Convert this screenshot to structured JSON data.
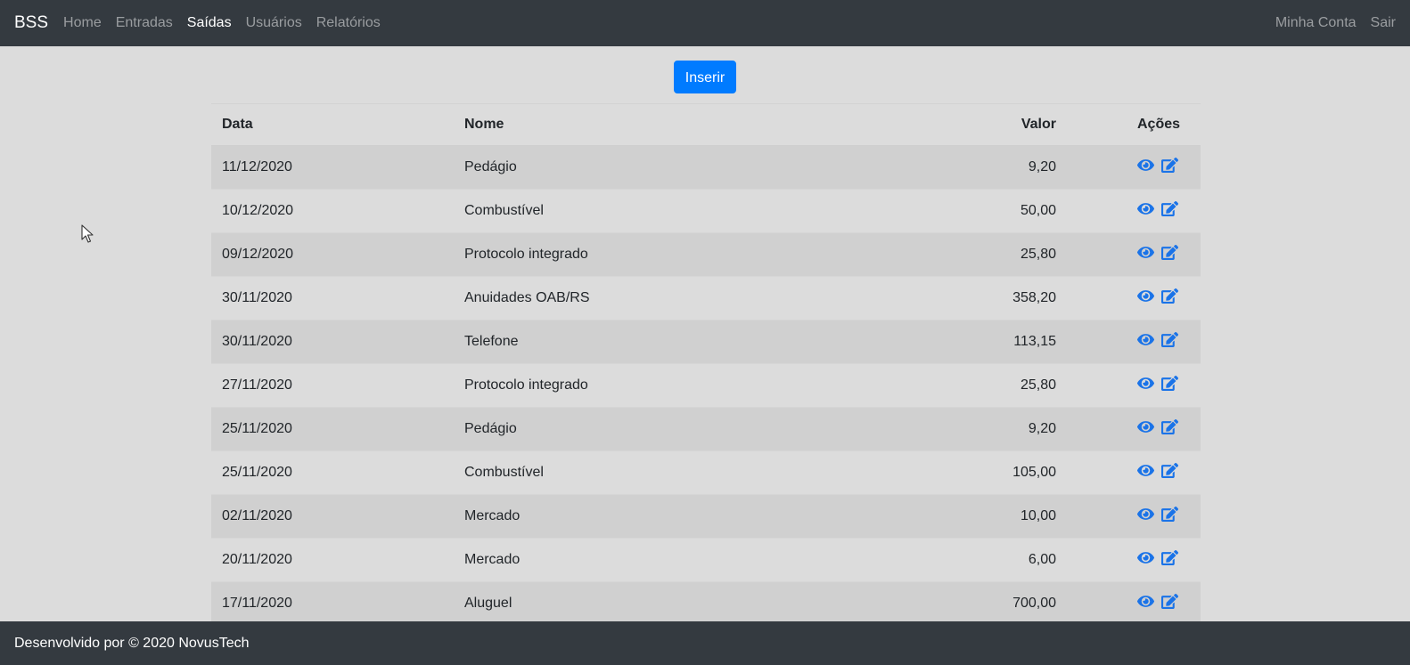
{
  "navbar": {
    "brand": "BSS",
    "links": [
      {
        "label": "Home",
        "active": false
      },
      {
        "label": "Entradas",
        "active": false
      },
      {
        "label": "Saídas",
        "active": true
      },
      {
        "label": "Usuários",
        "active": false
      },
      {
        "label": "Relatórios",
        "active": false
      }
    ],
    "right_links": [
      {
        "label": "Minha Conta"
      },
      {
        "label": "Sair"
      }
    ]
  },
  "actions": {
    "insert_label": "Inserir"
  },
  "table": {
    "headers": {
      "data": "Data",
      "nome": "Nome",
      "valor": "Valor",
      "acoes": "Ações"
    },
    "rows": [
      {
        "data": "11/12/2020",
        "nome": "Pedágio",
        "valor": "9,20"
      },
      {
        "data": "10/12/2020",
        "nome": "Combustível",
        "valor": "50,00"
      },
      {
        "data": "09/12/2020",
        "nome": "Protocolo integrado",
        "valor": "25,80"
      },
      {
        "data": "30/11/2020",
        "nome": "Anuidades OAB/RS",
        "valor": "358,20"
      },
      {
        "data": "30/11/2020",
        "nome": "Telefone",
        "valor": "113,15"
      },
      {
        "data": "27/11/2020",
        "nome": "Protocolo integrado",
        "valor": "25,80"
      },
      {
        "data": "25/11/2020",
        "nome": "Pedágio",
        "valor": "9,20"
      },
      {
        "data": "25/11/2020",
        "nome": "Combustível",
        "valor": "105,00"
      },
      {
        "data": "02/11/2020",
        "nome": "Mercado",
        "valor": "10,00"
      },
      {
        "data": "20/11/2020",
        "nome": "Mercado",
        "valor": "6,00"
      },
      {
        "data": "17/11/2020",
        "nome": "Aluguel",
        "valor": "700,00"
      }
    ],
    "row_action_icons": [
      "eye-icon",
      "edit-icon"
    ]
  },
  "footer": {
    "text": "Desenvolvido por © 2020 NovusTech"
  },
  "colors": {
    "navbar_bg": "#343a40",
    "page_bg": "#dcdcdc",
    "accent": "#007bff",
    "icon": "#1a73e8"
  }
}
